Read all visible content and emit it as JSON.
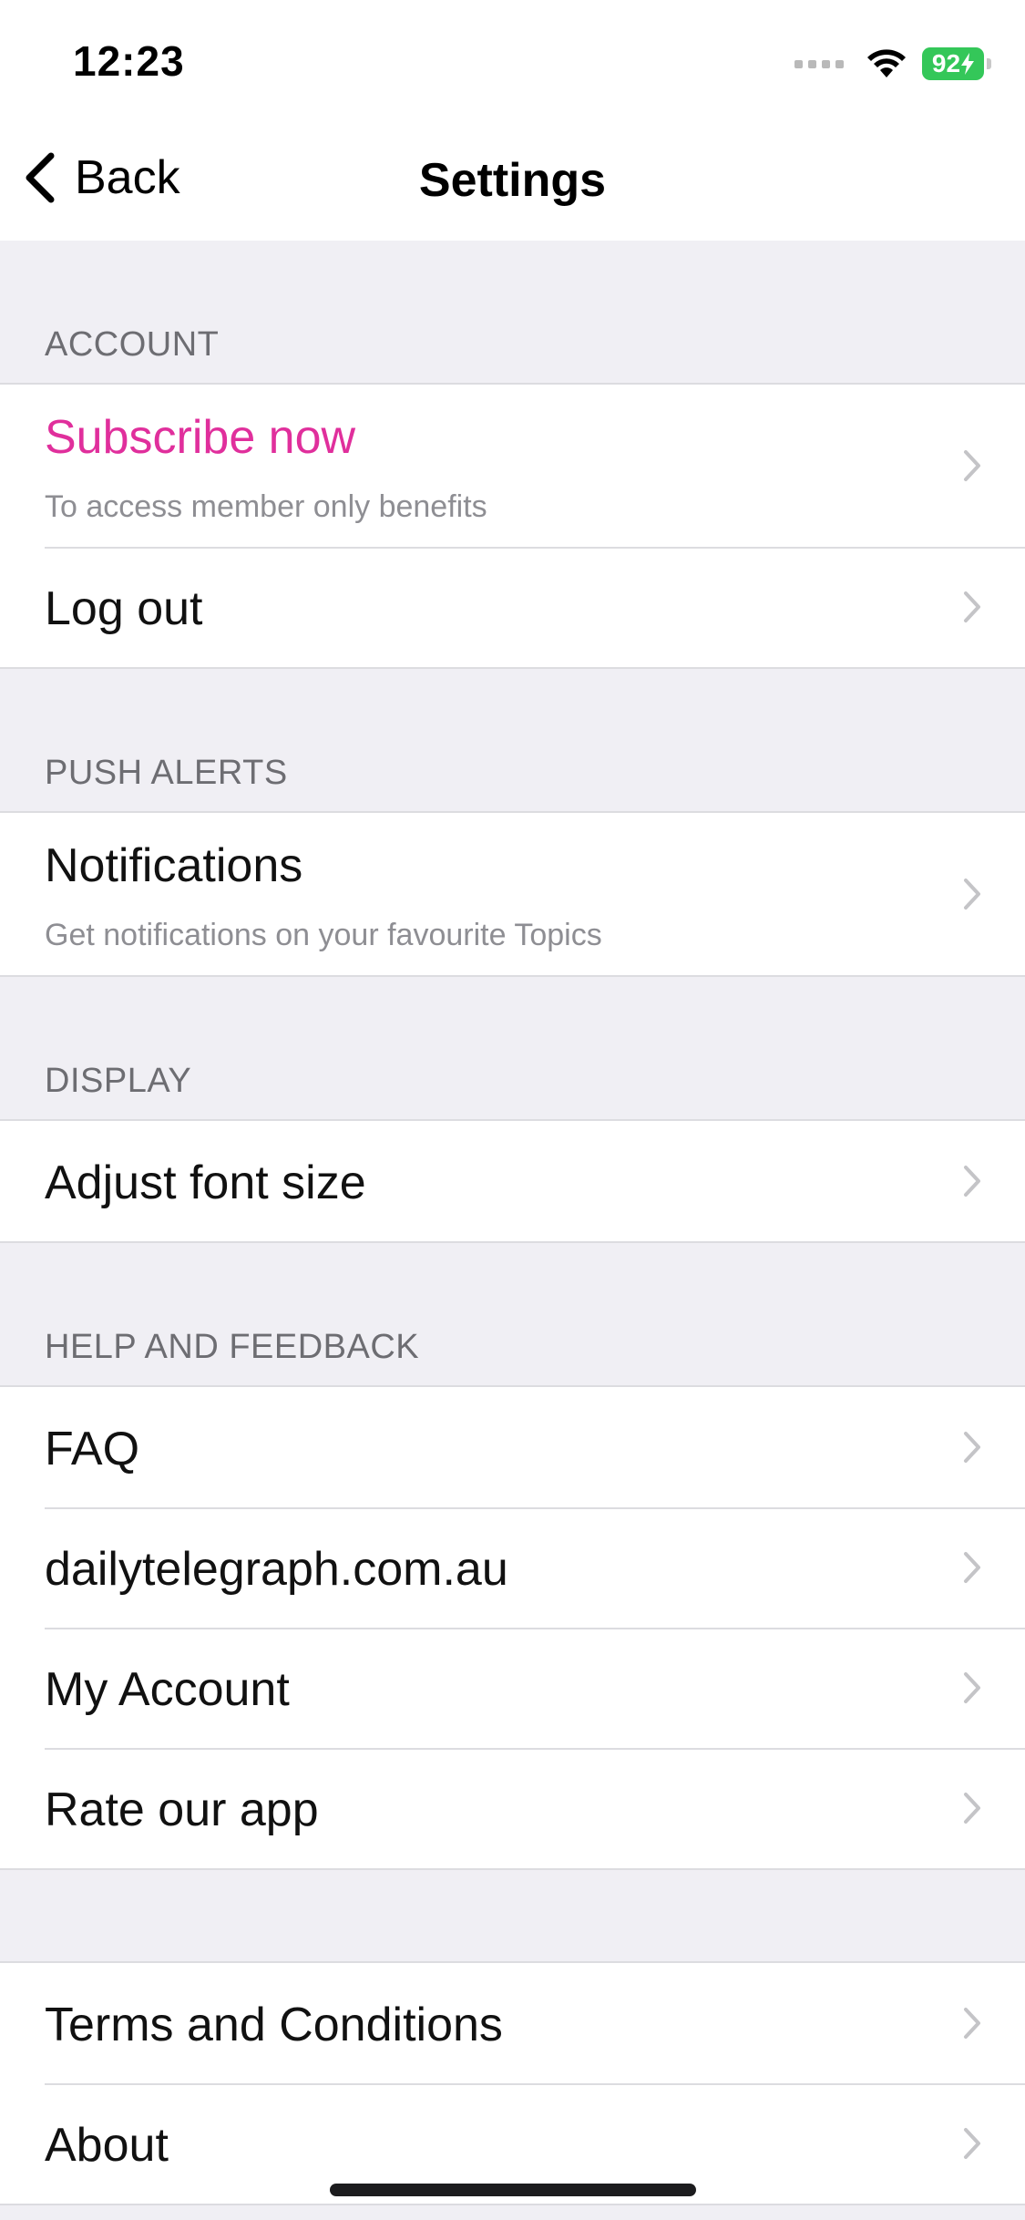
{
  "status_bar": {
    "time": "12:23",
    "battery": "92"
  },
  "nav": {
    "back_label": "Back",
    "title": "Settings"
  },
  "sections": {
    "account": {
      "header": "ACCOUNT",
      "subscribe_title": "Subscribe now",
      "subscribe_subtitle": "To access member only benefits",
      "logout": "Log out"
    },
    "push_alerts": {
      "header": "PUSH ALERTS",
      "notifications_title": "Notifications",
      "notifications_subtitle": "Get notifications on your favourite Topics"
    },
    "display": {
      "header": "DISPLAY",
      "font_size": "Adjust font size"
    },
    "help": {
      "header": "HELP AND FEEDBACK",
      "faq": "FAQ",
      "website": "dailytelegraph.com.au",
      "my_account": "My Account",
      "rate": "Rate our app"
    },
    "legal": {
      "terms": "Terms and Conditions",
      "about": "About"
    }
  },
  "colors": {
    "accent": "#e02f9c",
    "battery": "#34c759",
    "background": "#f0eff4"
  },
  "icons": {
    "back": "chevron-left-icon",
    "row": "chevron-right-icon",
    "wifi": "wifi-icon",
    "battery": "battery-icon"
  }
}
